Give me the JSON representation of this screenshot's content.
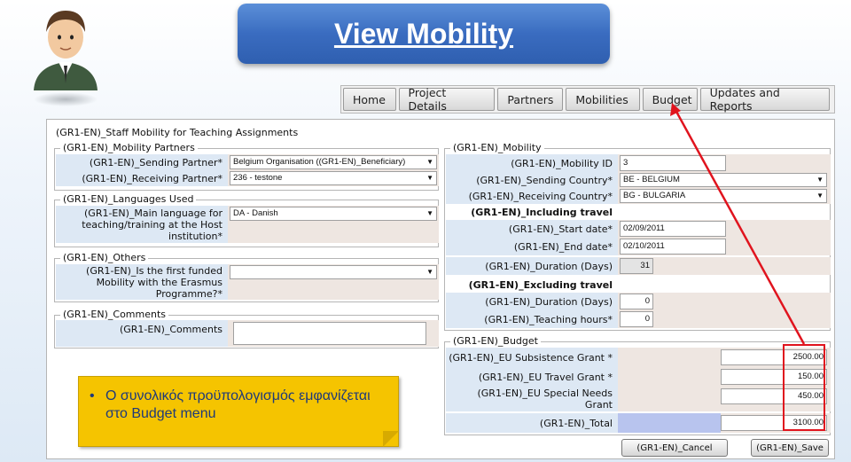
{
  "title": "View Mobility",
  "menu": [
    "Home",
    "Project Details",
    "Partners",
    "Mobilities",
    "Budget",
    "Updates and Reports"
  ],
  "panel_title": "(GR1-EN)_Staff Mobility for Teaching Assignments",
  "partners": {
    "legend": "(GR1-EN)_Mobility Partners",
    "sending_label": "(GR1-EN)_Sending Partner*",
    "sending_value": "Belgium Organisation ((GR1-EN)_Beneficiary)",
    "receiving_label": "(GR1-EN)_Receiving Partner*",
    "receiving_value": "236 - testone"
  },
  "languages": {
    "legend": "(GR1-EN)_Languages Used",
    "main_label": "(GR1-EN)_Main language for teaching/training at the Host institution*",
    "main_value": "DA - Danish"
  },
  "others": {
    "legend": "(GR1-EN)_Others",
    "first_label": "(GR1-EN)_Is the first funded Mobility with the Erasmus Programme?*",
    "first_value": ""
  },
  "comments": {
    "legend": "(GR1-EN)_Comments",
    "label": "(GR1-EN)_Comments",
    "value": ""
  },
  "mobility": {
    "legend": "(GR1-EN)_Mobility",
    "id_label": "(GR1-EN)_Mobility ID",
    "id_value": "3",
    "sending_country_label": "(GR1-EN)_Sending Country*",
    "sending_country_value": "BE - BELGIUM",
    "receiving_country_label": "(GR1-EN)_Receiving Country*",
    "receiving_country_value": "BG - BULGARIA",
    "including_travel": "(GR1-EN)_Including travel",
    "start_label": "(GR1-EN)_Start date*",
    "start_value": "02/09/2011",
    "end_label": "(GR1-EN)_End date*",
    "end_value": "02/10/2011",
    "duration_label": "(GR1-EN)_Duration (Days)",
    "duration_value": "31",
    "excluding_travel": "(GR1-EN)_Excluding travel",
    "duration2_label": "(GR1-EN)_Duration (Days)",
    "duration2_value": "0",
    "teaching_label": "(GR1-EN)_Teaching hours*",
    "teaching_value": "0"
  },
  "budget": {
    "legend": "(GR1-EN)_Budget",
    "subsistence_label": "(GR1-EN)_EU Subsistence Grant *",
    "subsistence_value": "2500.00",
    "travel_label": "(GR1-EN)_EU Travel Grant *",
    "travel_value": "150.00",
    "special_label": "(GR1-EN)_EU Special Needs Grant",
    "special_value": "450.00",
    "total_label": "(GR1-EN)_Total",
    "total_value": "3100.00"
  },
  "buttons": {
    "cancel": "(GR1-EN)_Cancel",
    "save": "(GR1-EN)_Save"
  },
  "note": {
    "bullet": "•",
    "text": "Ο συνολικός προϋπολογισμός εμφανίζεται στο Budget menu"
  },
  "colors": {
    "banner": "#3a6cc0",
    "label_bg": "#dde8f4",
    "value_bg": "#eee6e1",
    "note_bg": "#f5c400",
    "highlight": "#e0141e"
  }
}
